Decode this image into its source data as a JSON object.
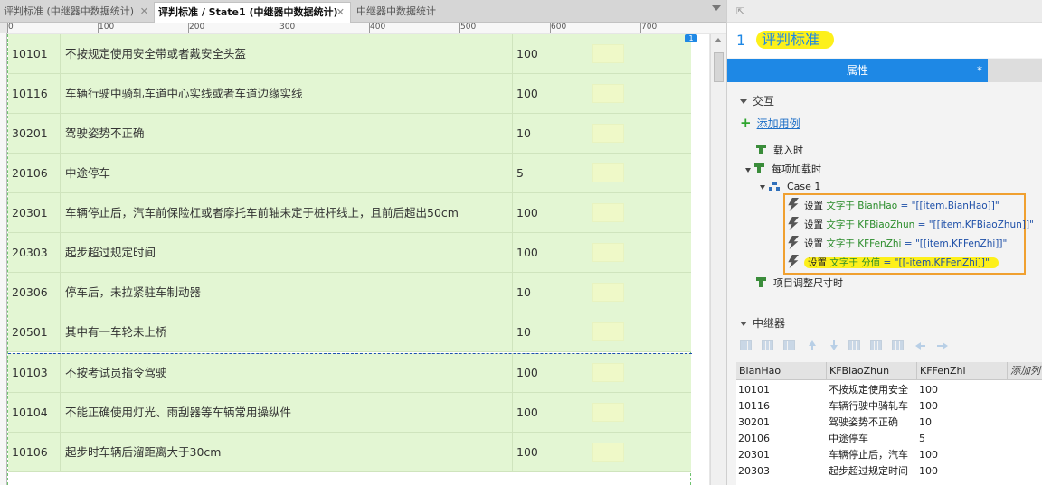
{
  "tabs": [
    {
      "label": "评判标准 (中继器中数据统计)",
      "active": false
    },
    {
      "label": "评判标准 / State1 (中继器中数据统计)",
      "active": true
    },
    {
      "label": "中继器中数据统计",
      "active": false
    }
  ],
  "ruler": {
    "labels": [
      "0",
      "100",
      "200",
      "300",
      "400",
      "500",
      "600",
      "700"
    ]
  },
  "canvas_rows": [
    {
      "code": "10101",
      "standard": "不按规定使用安全带或者戴安全头盔",
      "score": "100"
    },
    {
      "code": "10116",
      "standard": "车辆行驶中骑轧车道中心实线或者车道边缘实线",
      "score": "100"
    },
    {
      "code": "30201",
      "standard": "驾驶姿势不正确",
      "score": "10"
    },
    {
      "code": "20106",
      "standard": "中途停车",
      "score": "5"
    },
    {
      "code": "20301",
      "standard": "车辆停止后，汽车前保险杠或者摩托车前轴未定于桩杆线上，且前后超出50cm",
      "score": "100"
    },
    {
      "code": "20303",
      "standard": "起步超过规定时间",
      "score": "100"
    },
    {
      "code": "20306",
      "standard": "停车后，未拉紧驻车制动器",
      "score": "10"
    },
    {
      "code": "20501",
      "standard": "其中有一车轮未上桥",
      "score": "10"
    },
    {
      "code": "10103",
      "standard": "不按考试员指令驾驶",
      "score": "100"
    },
    {
      "code": "10104",
      "standard": "不能正确使用灯光、雨刮器等车辆常用操纵件",
      "score": "100"
    },
    {
      "code": "10106",
      "standard": "起步时车辆后溜距离大于30cm",
      "score": "100"
    }
  ],
  "repeater_marker": "1",
  "panel": {
    "widget_number": "1",
    "widget_name": "评判标准",
    "properties_tab": "属性",
    "properties_tab_star": "*",
    "interactions_section": "交互",
    "add_case": "添加用例",
    "event_onload": "载入时",
    "event_item_load": "每项加载时",
    "case_label": "Case 1",
    "event_item_resize": "项目调整尺寸时",
    "repeater_section": "中继器"
  },
  "actions": [
    {
      "verb": "设置",
      "kw": "文字于",
      "target": "BianHao",
      "value": " = \"[[item.BianHao]]\"",
      "highlighted": false
    },
    {
      "verb": "设置",
      "kw": "文字于",
      "target": "KFBiaoZhun",
      "value": " = \"[[item.KFBiaoZhun]]\"",
      "highlighted": false
    },
    {
      "verb": "设置",
      "kw": "文字于",
      "target": "KFFenZhi",
      "value": " = \"[[item.KFFenZhi]]\"",
      "highlighted": false
    },
    {
      "verb": "设置",
      "kw": "文字于",
      "target": "分值",
      "value": " = \"[[-item.KFFenZhi]]\"",
      "highlighted": true
    }
  ],
  "grid": {
    "headers": [
      "BianHao",
      "KFBiaoZhun",
      "KFFenZhi",
      "添加列"
    ],
    "rows": [
      [
        "10101",
        "不按规定使用安全",
        "100"
      ],
      [
        "10116",
        "车辆行驶中骑轧车",
        "100"
      ],
      [
        "30201",
        "驾驶姿势不正确",
        "10"
      ],
      [
        "20106",
        "中途停车",
        "5"
      ],
      [
        "20301",
        "车辆停止后，汽车",
        "100"
      ],
      [
        "20303",
        "起步超过规定时间",
        "100"
      ]
    ]
  },
  "colors": {
    "accent": "#1e88e5",
    "row_bg": "#e3f6d3",
    "highlight": "#fdf01a",
    "actions_border": "#f0a030",
    "keyword_green": "#2a8c2a"
  }
}
